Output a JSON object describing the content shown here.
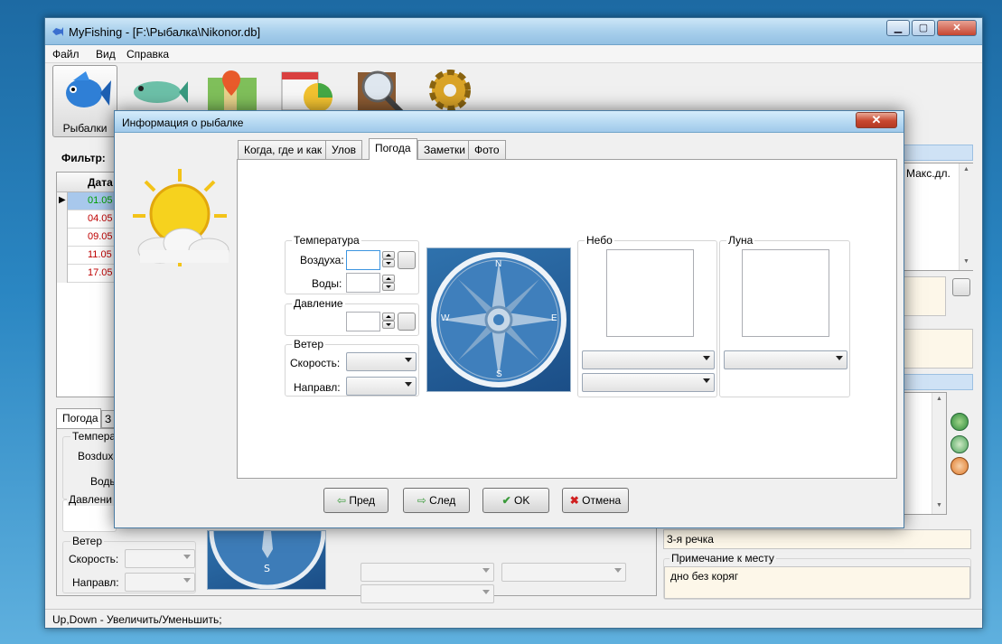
{
  "window": {
    "title": "MyFishing - [F:\\Рыбалка\\Nikonor.db]"
  },
  "menu": [
    "Файл",
    "Вид",
    "Справка"
  ],
  "toolbar": {
    "active_label": "Рыбалки"
  },
  "filter": {
    "label": "Фильтр:"
  },
  "grid": {
    "date_header": "Дата",
    "rows": [
      "01.05",
      "04.05",
      "09.05",
      "11.05",
      "17.05"
    ]
  },
  "right_panel": {
    "max_len_header": "Макс.дл."
  },
  "lower_tabs": {
    "weather": "Погода",
    "other_stub": "З"
  },
  "bottom_weather": {
    "temp_caption": "Темпера",
    "air_label": "Возduxa",
    "water_label": "Воды",
    "pressure_caption": "Давлени",
    "wind_caption": "Ветер",
    "speed_label": "Скорость:",
    "direction_label": "Направл:"
  },
  "place": {
    "name_value": "3-я речка",
    "note_caption": "Примечание к месту",
    "note_value": "дно без коряг"
  },
  "status": {
    "text": "Up,Down - Увеличить/Уменьшить;"
  },
  "dialog": {
    "title": "Информация о рыбалке",
    "tabs": [
      "Когда, где и как",
      "Улов",
      "Погода",
      "Заметки",
      "Фото"
    ],
    "active_tab": "Погода",
    "temperature": {
      "caption": "Температура",
      "air_label": "Воздуха:",
      "water_label": "Воды:"
    },
    "pressure": {
      "caption": "Давление"
    },
    "wind": {
      "caption": "Ветер",
      "speed_label": "Скорость:",
      "direction_label": "Направл:"
    },
    "sky": {
      "caption": "Небо"
    },
    "moon": {
      "caption": "Луна"
    },
    "compass": {
      "n": "N",
      "e": "E",
      "s": "S",
      "w": "W"
    },
    "buttons": {
      "prev": "Пред",
      "next": "След",
      "ok": "OK",
      "cancel": "Отмена"
    }
  },
  "colors": {
    "row_first": "#00a000",
    "row_other": "#c00000",
    "selected_row_bg": "#a8c8ec"
  }
}
